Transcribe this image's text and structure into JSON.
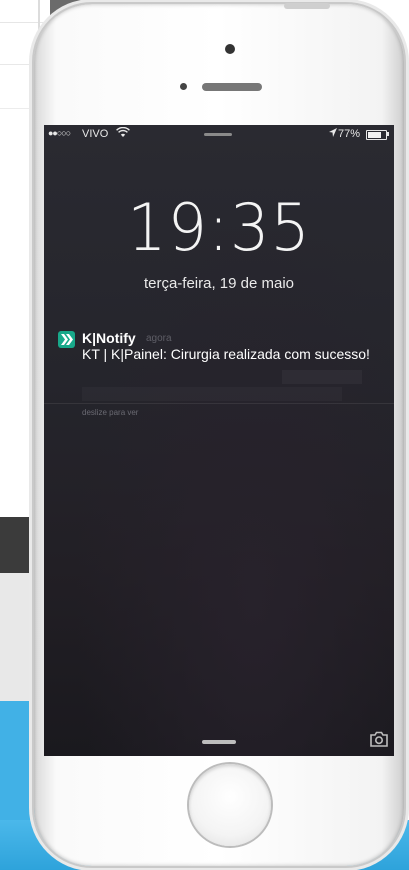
{
  "status_bar": {
    "signal": "●●○○○",
    "carrier": "VIVO",
    "wifi_icon": "wifi-icon",
    "location_icon": "location-arrow-icon",
    "battery_percent": "77%",
    "battery_level": 0.77
  },
  "lock_screen": {
    "time": "19:35",
    "date": "terça-feira, 19 de maio"
  },
  "notification": {
    "app_name": "K|Notify",
    "timestamp": "agora",
    "message": "KT | K|Painel: Cirurgia realizada com sucesso!",
    "slide_hint": "deslize para ver",
    "icon_color": "#18a88a"
  },
  "colors": {
    "screen_bg": "#25252c",
    "site_blue": "#41b1e6"
  }
}
